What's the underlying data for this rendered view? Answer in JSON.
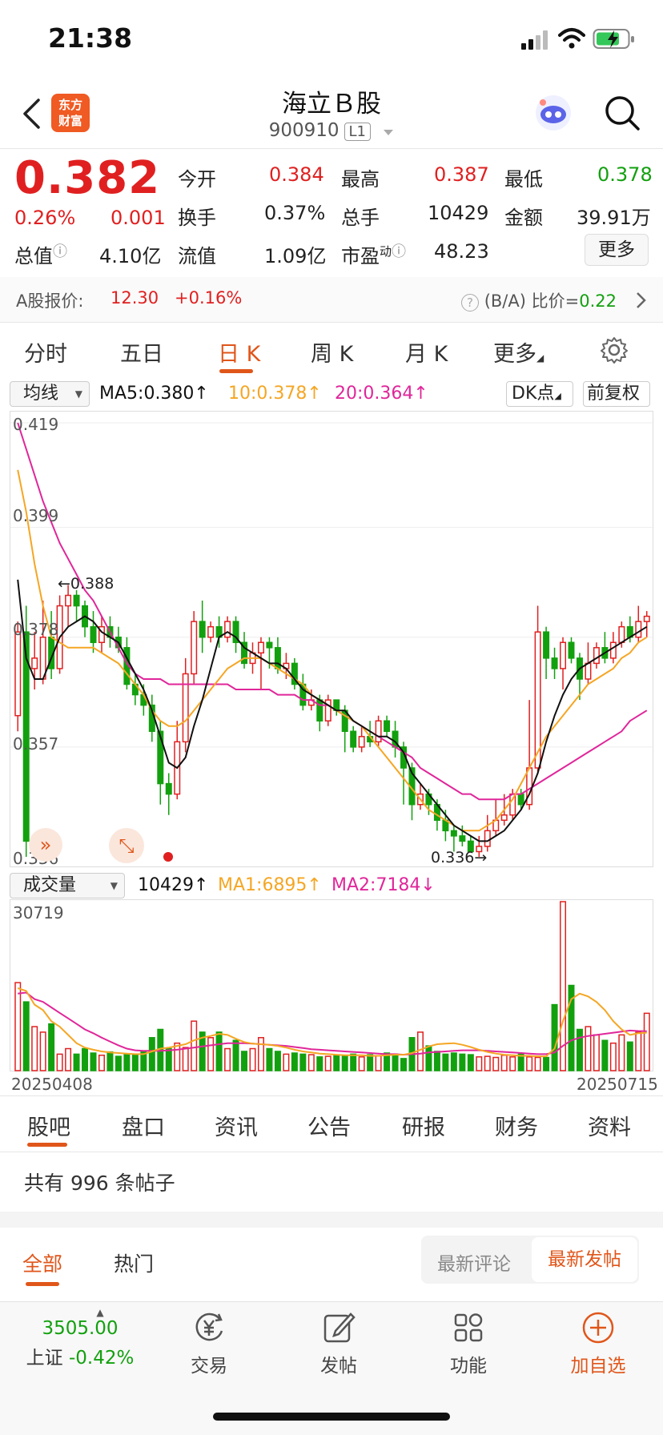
{
  "status_bar": {
    "time": "21:38"
  },
  "header": {
    "title": "海立Ｂ股",
    "code": "900910",
    "level_badge": "L1",
    "logo_text_1": "东方",
    "logo_text_2": "财富",
    "back_icon": "chevron-left-icon",
    "robot_icon": "robot-assistant-icon",
    "search_icon": "search-icon"
  },
  "quote": {
    "price": "0.382",
    "change_pct": "0.26%",
    "change_amt": "0.001",
    "open_label": "今开",
    "open_value": "0.384",
    "high_label": "最高",
    "high_value": "0.387",
    "low_label": "最低",
    "low_value": "0.378",
    "turnover_label": "换手",
    "turnover_value": "0.37%",
    "volume_label": "总手",
    "volume_value": "10429",
    "amount_label": "金额",
    "amount_value": "39.91万",
    "mktcap_label": "总值",
    "mktcap_value": "4.10亿",
    "float_label": "流值",
    "float_value": "1.09亿",
    "pe_label": "市盈",
    "pe_sup": "动",
    "pe_value": "48.23",
    "more_label": "更多"
  },
  "ashare": {
    "label": "A股报价:",
    "price": "12.30",
    "change": "+0.16%",
    "ratio_label": "(B/A) 比价=",
    "ratio_value": "0.22"
  },
  "chart_tabs": [
    "分时",
    "五日",
    "日 K",
    "周 K",
    "月 K",
    "更多"
  ],
  "ma_bar": {
    "select": "均线",
    "ma5": "MA5:0.380↑",
    "ma10": "10:0.378↑",
    "ma20": "20:0.364↑",
    "dk": "DK点",
    "adjust": "前复权"
  },
  "vol_bar": {
    "select": "成交量",
    "vol": "10429↑",
    "ma1": "MA1:6895↑",
    "ma2": "MA2:7184↓"
  },
  "colors": {
    "up": "#e02020",
    "down": "#13a00f",
    "accent": "#e0561a",
    "ma5": "#111111",
    "ma10": "#f5a623",
    "ma20": "#e0269a"
  },
  "chart_data": {
    "type": "candlestick",
    "price_axis_labels": [
      "0.419",
      "0.399",
      "0.378",
      "0.357",
      "0.336"
    ],
    "ylim": [
      0.336,
      0.419
    ],
    "high_marker": "←0.388",
    "low_marker": "0.336→",
    "start_date": "20250408",
    "end_date": "20250715",
    "candles": [
      [
        0.363,
        0.379,
        0.381,
        0.36
      ],
      [
        0.379,
        0.339,
        0.384,
        0.336
      ],
      [
        0.372,
        0.374,
        0.379,
        0.368
      ],
      [
        0.37,
        0.378,
        0.385,
        0.369
      ],
      [
        0.378,
        0.372,
        0.383,
        0.37
      ],
      [
        0.372,
        0.384,
        0.386,
        0.371
      ],
      [
        0.384,
        0.386,
        0.388,
        0.38
      ],
      [
        0.386,
        0.384,
        0.387,
        0.381
      ],
      [
        0.384,
        0.38,
        0.385,
        0.378
      ],
      [
        0.38,
        0.377,
        0.383,
        0.375
      ],
      [
        0.377,
        0.38,
        0.382,
        0.375
      ],
      [
        0.38,
        0.378,
        0.382,
        0.376
      ],
      [
        0.378,
        0.376,
        0.38,
        0.375
      ],
      [
        0.376,
        0.369,
        0.378,
        0.368
      ],
      [
        0.369,
        0.367,
        0.371,
        0.365
      ],
      [
        0.367,
        0.365,
        0.369,
        0.363
      ],
      [
        0.365,
        0.36,
        0.367,
        0.358
      ],
      [
        0.36,
        0.35,
        0.362,
        0.346
      ],
      [
        0.35,
        0.348,
        0.352,
        0.344
      ],
      [
        0.348,
        0.358,
        0.362,
        0.347
      ],
      [
        0.358,
        0.371,
        0.374,
        0.356
      ],
      [
        0.371,
        0.381,
        0.383,
        0.369
      ],
      [
        0.381,
        0.378,
        0.385,
        0.375
      ],
      [
        0.378,
        0.38,
        0.381,
        0.377
      ],
      [
        0.38,
        0.378,
        0.382,
        0.376
      ],
      [
        0.378,
        0.381,
        0.382,
        0.377
      ],
      [
        0.381,
        0.377,
        0.382,
        0.375
      ],
      [
        0.377,
        0.373,
        0.379,
        0.372
      ],
      [
        0.373,
        0.375,
        0.377,
        0.371
      ],
      [
        0.375,
        0.377,
        0.378,
        0.368
      ],
      [
        0.377,
        0.376,
        0.378,
        0.372
      ],
      [
        0.376,
        0.372,
        0.378,
        0.371
      ],
      [
        0.372,
        0.373,
        0.375,
        0.37
      ],
      [
        0.373,
        0.369,
        0.374,
        0.368
      ],
      [
        0.369,
        0.365,
        0.371,
        0.364
      ],
      [
        0.365,
        0.366,
        0.368,
        0.364
      ],
      [
        0.366,
        0.362,
        0.367,
        0.36
      ],
      [
        0.362,
        0.366,
        0.367,
        0.361
      ],
      [
        0.366,
        0.364,
        0.366,
        0.363
      ],
      [
        0.364,
        0.36,
        0.365,
        0.356
      ],
      [
        0.36,
        0.357,
        0.361,
        0.356
      ],
      [
        0.357,
        0.359,
        0.361,
        0.356
      ],
      [
        0.359,
        0.358,
        0.362,
        0.357
      ],
      [
        0.358,
        0.362,
        0.363,
        0.357
      ],
      [
        0.362,
        0.36,
        0.363,
        0.359
      ],
      [
        0.36,
        0.357,
        0.362,
        0.355
      ],
      [
        0.357,
        0.353,
        0.358,
        0.346
      ],
      [
        0.353,
        0.346,
        0.354,
        0.343
      ],
      [
        0.346,
        0.348,
        0.35,
        0.345
      ],
      [
        0.348,
        0.346,
        0.349,
        0.344
      ],
      [
        0.346,
        0.343,
        0.347,
        0.341
      ],
      [
        0.343,
        0.341,
        0.345,
        0.339
      ],
      [
        0.341,
        0.34,
        0.342,
        0.337
      ],
      [
        0.34,
        0.339,
        0.342,
        0.338
      ],
      [
        0.339,
        0.337,
        0.34,
        0.337
      ],
      [
        0.337,
        0.338,
        0.34,
        0.336
      ],
      [
        0.338,
        0.341,
        0.344,
        0.337
      ],
      [
        0.341,
        0.343,
        0.347,
        0.34
      ],
      [
        0.343,
        0.344,
        0.348,
        0.342
      ],
      [
        0.344,
        0.348,
        0.349,
        0.343
      ],
      [
        0.348,
        0.346,
        0.349,
        0.345
      ],
      [
        0.346,
        0.353,
        0.366,
        0.345
      ],
      [
        0.353,
        0.379,
        0.384,
        0.352
      ],
      [
        0.379,
        0.374,
        0.38,
        0.37
      ],
      [
        0.374,
        0.372,
        0.376,
        0.37
      ],
      [
        0.372,
        0.377,
        0.378,
        0.368
      ],
      [
        0.377,
        0.374,
        0.378,
        0.373
      ],
      [
        0.374,
        0.37,
        0.375,
        0.366
      ],
      [
        0.37,
        0.373,
        0.377,
        0.369
      ],
      [
        0.373,
        0.376,
        0.377,
        0.372
      ],
      [
        0.376,
        0.374,
        0.379,
        0.373
      ],
      [
        0.374,
        0.377,
        0.379,
        0.373
      ],
      [
        0.377,
        0.38,
        0.381,
        0.376
      ],
      [
        0.38,
        0.378,
        0.382,
        0.377
      ],
      [
        0.378,
        0.381,
        0.384,
        0.377
      ],
      [
        0.381,
        0.382,
        0.383,
        0.378
      ]
    ],
    "ma5": [
      0.389,
      0.374,
      0.37,
      0.37,
      0.374,
      0.378,
      0.38,
      0.381,
      0.382,
      0.381,
      0.379,
      0.378,
      0.377,
      0.374,
      0.371,
      0.368,
      0.364,
      0.359,
      0.354,
      0.353,
      0.355,
      0.361,
      0.366,
      0.372,
      0.378,
      0.379,
      0.378,
      0.376,
      0.375,
      0.374,
      0.373,
      0.373,
      0.372,
      0.37,
      0.368,
      0.367,
      0.366,
      0.365,
      0.364,
      0.364,
      0.362,
      0.361,
      0.36,
      0.359,
      0.359,
      0.358,
      0.356,
      0.352,
      0.35,
      0.348,
      0.346,
      0.344,
      0.342,
      0.341,
      0.34,
      0.339,
      0.339,
      0.34,
      0.341,
      0.343,
      0.345,
      0.348,
      0.352,
      0.358,
      0.363,
      0.367,
      0.37,
      0.372,
      0.373,
      0.374,
      0.375,
      0.376,
      0.377,
      0.378,
      0.379,
      0.38
    ],
    "ma10": [
      0.41,
      0.402,
      0.392,
      0.384,
      0.378,
      0.377,
      0.376,
      0.376,
      0.376,
      0.376,
      0.375,
      0.374,
      0.373,
      0.371,
      0.369,
      0.367,
      0.364,
      0.362,
      0.361,
      0.361,
      0.362,
      0.364,
      0.366,
      0.368,
      0.37,
      0.372,
      0.373,
      0.374,
      0.374,
      0.374,
      0.373,
      0.372,
      0.371,
      0.37,
      0.369,
      0.367,
      0.366,
      0.365,
      0.364,
      0.363,
      0.362,
      0.361,
      0.359,
      0.357,
      0.355,
      0.353,
      0.351,
      0.349,
      0.347,
      0.345,
      0.344,
      0.343,
      0.342,
      0.341,
      0.341,
      0.341,
      0.342,
      0.343,
      0.345,
      0.347,
      0.35,
      0.353,
      0.356,
      0.359,
      0.361,
      0.363,
      0.365,
      0.367,
      0.369,
      0.37,
      0.371,
      0.372,
      0.374,
      0.375,
      0.377,
      0.378
    ],
    "ma20": [
      0.419,
      0.414,
      0.409,
      0.404,
      0.4,
      0.396,
      0.393,
      0.39,
      0.387,
      0.385,
      0.382,
      0.379,
      0.376,
      0.373,
      0.371,
      0.37,
      0.37,
      0.37,
      0.369,
      0.369,
      0.369,
      0.369,
      0.369,
      0.369,
      0.369,
      0.369,
      0.368,
      0.368,
      0.368,
      0.368,
      0.368,
      0.367,
      0.367,
      0.367,
      0.366,
      0.366,
      0.365,
      0.365,
      0.364,
      0.363,
      0.362,
      0.361,
      0.36,
      0.359,
      0.358,
      0.357,
      0.356,
      0.355,
      0.353,
      0.352,
      0.351,
      0.35,
      0.349,
      0.348,
      0.348,
      0.347,
      0.347,
      0.347,
      0.347,
      0.348,
      0.348,
      0.349,
      0.35,
      0.351,
      0.352,
      0.353,
      0.354,
      0.355,
      0.356,
      0.357,
      0.358,
      0.359,
      0.36,
      0.362,
      0.363,
      0.364
    ],
    "volume_axis_label": "30719",
    "volume_ylim": [
      0,
      30719
    ],
    "volumes": [
      16000,
      12500,
      8000,
      7000,
      8500,
      3000,
      4000,
      3000,
      4000,
      3200,
      2800,
      3400,
      2600,
      3000,
      2900,
      3500,
      6000,
      7500,
      4000,
      5000,
      4200,
      9000,
      7000,
      6000,
      7000,
      4000,
      5500,
      3500,
      4000,
      6000,
      4000,
      3500,
      3000,
      3200,
      3000,
      2900,
      2500,
      2600,
      2800,
      2700,
      3000,
      2500,
      2900,
      2700,
      3200,
      3000,
      2200,
      6000,
      7000,
      4500,
      3500,
      3000,
      3200,
      3000,
      2900,
      2500,
      2600,
      2400,
      2800,
      2500,
      3000,
      2500,
      2400,
      2400,
      12000,
      30719,
      15500,
      7500,
      8000,
      6500,
      5500,
      5000,
      6500,
      5200,
      7000,
      10429
    ],
    "vol_ma1": [
      15000,
      14500,
      12000,
      11000,
      9000,
      8000,
      6500,
      5000,
      4200,
      3800,
      3500,
      3300,
      3200,
      3100,
      3000,
      3000,
      3500,
      4000,
      4200,
      4500,
      4800,
      5500,
      6000,
      6300,
      6700,
      6500,
      5800,
      5200,
      4900,
      4800,
      4700,
      4500,
      4200,
      3800,
      3500,
      3300,
      3100,
      3000,
      2900,
      2800,
      2800,
      2800,
      2700,
      2700,
      2800,
      2900,
      2900,
      3200,
      3800,
      4400,
      4800,
      4900,
      5000,
      4700,
      4300,
      3800,
      3400,
      3100,
      2900,
      2800,
      2700,
      2700,
      2600,
      2600,
      4000,
      9000,
      13000,
      14000,
      13500,
      12500,
      11000,
      9000,
      7500,
      6500,
      6800,
      6895
    ],
    "vol_ma2": [
      14000,
      14200,
      13000,
      12500,
      11500,
      10500,
      9500,
      8500,
      7500,
      6800,
      6000,
      5300,
      4600,
      4000,
      3700,
      3600,
      3600,
      3600,
      3700,
      3800,
      4000,
      4200,
      4400,
      4600,
      4800,
      5000,
      5000,
      5000,
      4900,
      4800,
      4700,
      4600,
      4500,
      4300,
      4100,
      3900,
      3800,
      3700,
      3600,
      3500,
      3400,
      3300,
      3200,
      3100,
      3000,
      3000,
      2900,
      3000,
      3100,
      3300,
      3400,
      3500,
      3600,
      3700,
      3700,
      3700,
      3600,
      3500,
      3400,
      3300,
      3200,
      3100,
      3000,
      3000,
      3300,
      4500,
      5500,
      6000,
      6300,
      6500,
      6700,
      6900,
      7100,
      7300,
      7200,
      7184
    ]
  },
  "bottom_tabs": [
    "股吧",
    "盘口",
    "资讯",
    "公告",
    "研报",
    "财务",
    "资料"
  ],
  "posts": {
    "count_text": "共有 996 条帖子",
    "filter_all": "全部",
    "filter_hot": "热门",
    "sort_comment": "最新评论",
    "sort_post": "最新发帖"
  },
  "nav": {
    "index_value": "3505.00",
    "index_name": "上证",
    "index_change": "-0.42%",
    "trade": "交易",
    "post": "发帖",
    "function": "功能",
    "add_watch": "加自选"
  }
}
